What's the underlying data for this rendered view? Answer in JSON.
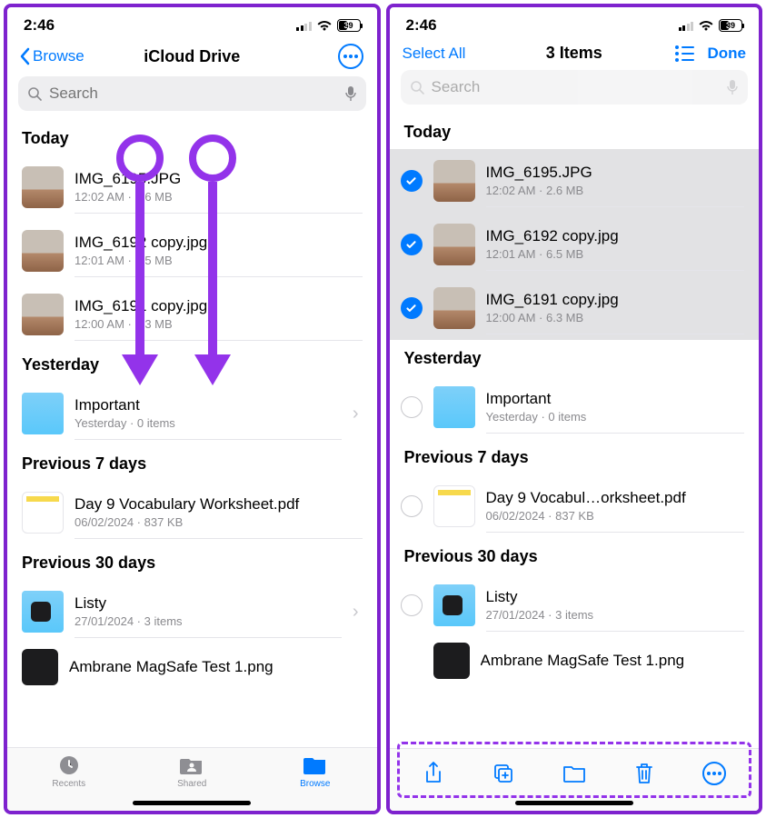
{
  "status": {
    "time": "2:46",
    "battery": "39"
  },
  "left": {
    "nav": {
      "back": "Browse",
      "title": "iCloud Drive"
    },
    "search_placeholder": "Search",
    "tabs": {
      "recents": "Recents",
      "shared": "Shared",
      "browse": "Browse"
    }
  },
  "right": {
    "nav": {
      "select_all": "Select All",
      "title": "3 Items",
      "done": "Done"
    },
    "search_placeholder": "Search"
  },
  "sections": {
    "today": "Today",
    "yesterday": "Yesterday",
    "prev7": "Previous 7 days",
    "prev30": "Previous 30 days"
  },
  "files": {
    "f1": {
      "name": "IMG_6195.JPG",
      "meta": "12:02 AM · 2.6 MB"
    },
    "f2": {
      "name": "IMG_6192 copy.jpg",
      "meta": "12:01 AM · 6.5 MB"
    },
    "f3": {
      "name": "IMG_6191 copy.jpg",
      "meta": "12:00 AM · 6.3 MB"
    },
    "important": {
      "name": "Important",
      "meta": "Yesterday · 0 items"
    },
    "vocab": {
      "name": "Day 9 Vocabulary Worksheet.pdf",
      "name_short": "Day 9 Vocabul…orksheet.pdf",
      "meta": "06/02/2024 · 837 KB"
    },
    "listy": {
      "name": "Listy",
      "meta": "27/01/2024 · 3 items"
    },
    "ambrane": {
      "name": "Ambrane MagSafe Test 1.png"
    }
  }
}
